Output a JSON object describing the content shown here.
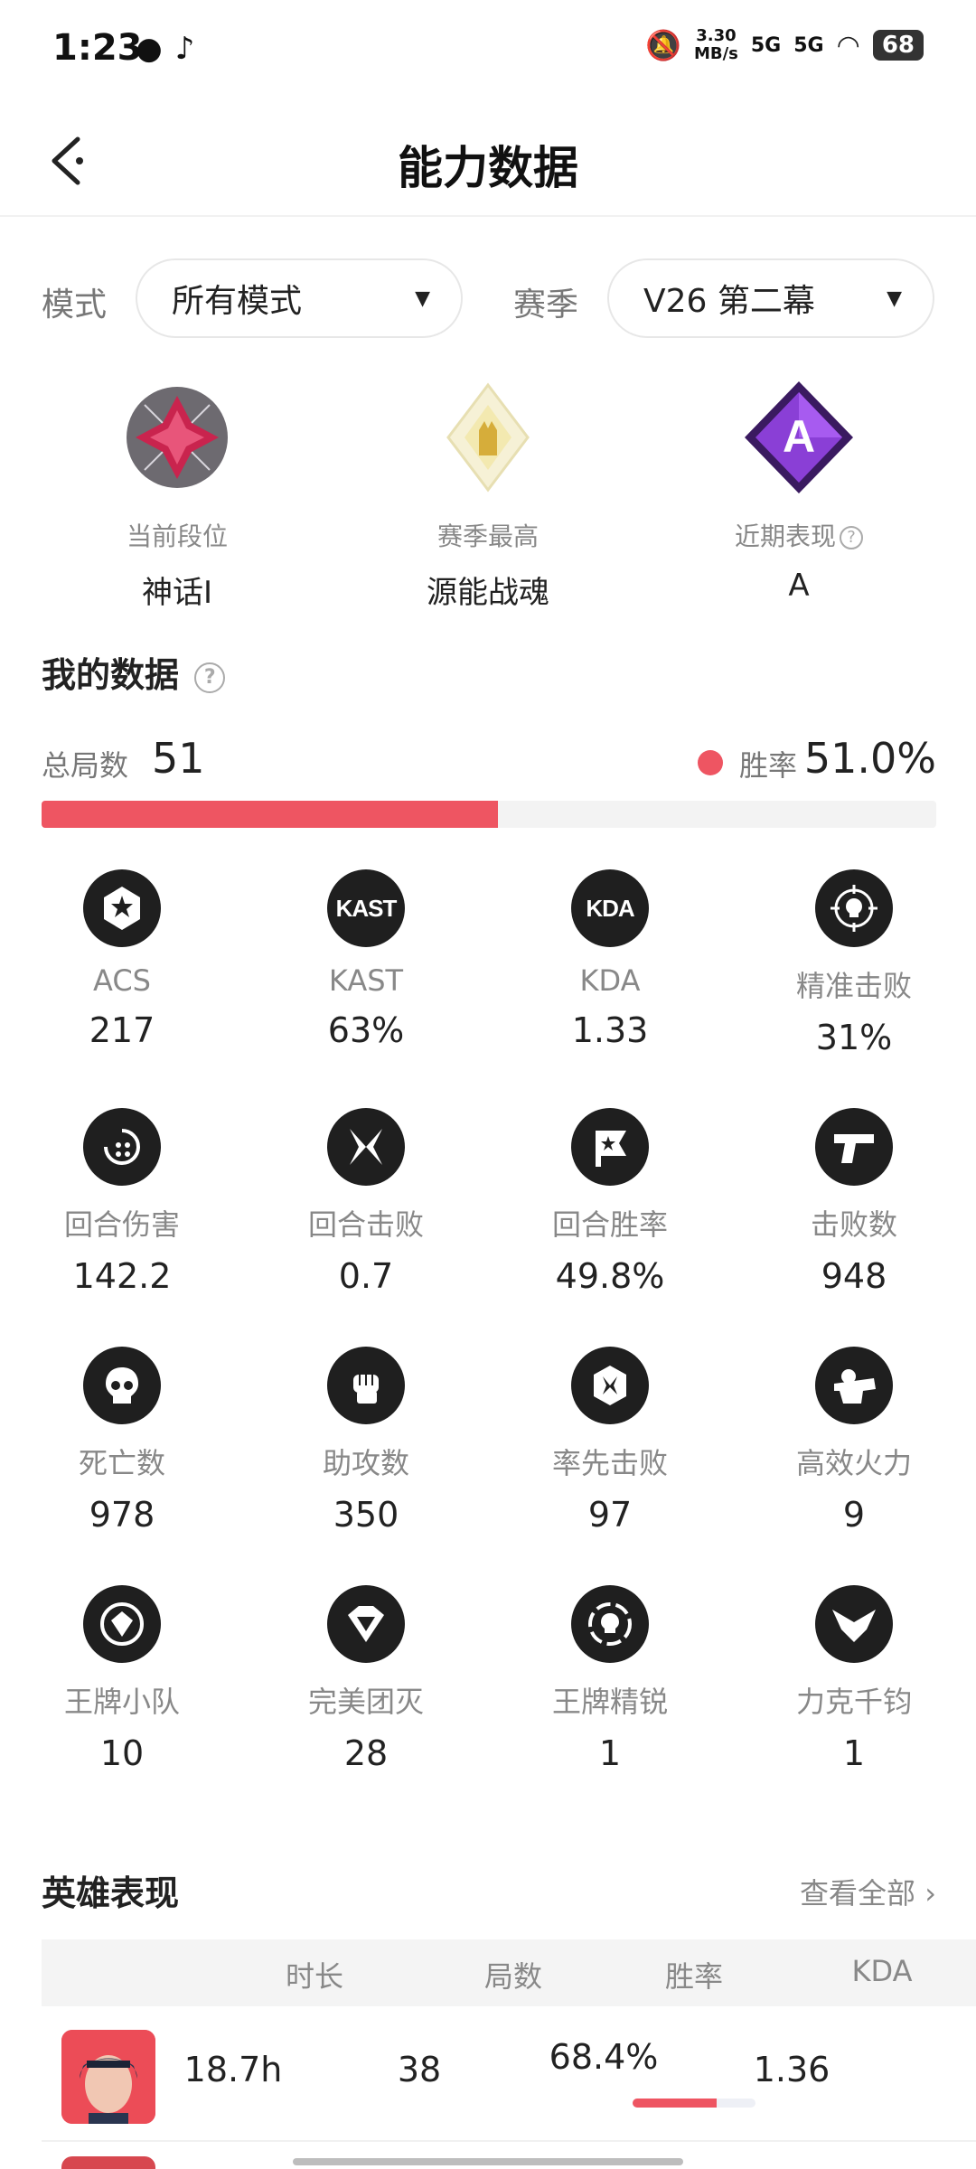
{
  "status_bar": {
    "time": "1:23",
    "net_speed_value": "3.30",
    "net_speed_unit": "MB/s",
    "signal_1": "5G",
    "signal_2": "5G",
    "battery": "68"
  },
  "nav": {
    "title": "能力数据"
  },
  "filters": {
    "mode_label": "模式",
    "mode_value": "所有模式",
    "season_label": "赛季",
    "season_value": "V26 第二幕"
  },
  "ranks": [
    {
      "label": "当前段位",
      "value": "神话I"
    },
    {
      "label": "赛季最高",
      "value": "源能战魂"
    },
    {
      "label": "近期表现",
      "value": "A"
    }
  ],
  "my_data": {
    "title": "我的数据",
    "total_label": "总局数",
    "total_value": "51",
    "winrate_label": "胜率",
    "winrate_value": "51.0%",
    "winrate_fraction": 0.51
  },
  "stats": [
    {
      "icon": "star-badge-icon",
      "label": "ACS",
      "value": "217"
    },
    {
      "icon": "kast-icon",
      "icon_text": "KAST",
      "label": "KAST",
      "value": "63%"
    },
    {
      "icon": "kda-icon",
      "icon_text": "KDA",
      "label": "KDA",
      "value": "1.33"
    },
    {
      "icon": "crosshair-skull-icon",
      "label": "精准击败",
      "value": "31%"
    },
    {
      "icon": "round-damage-icon",
      "label": "回合伤害",
      "value": "142.2"
    },
    {
      "icon": "crossed-blades-icon",
      "label": "回合击败",
      "value": "0.7"
    },
    {
      "icon": "flag-star-icon",
      "label": "回合胜率",
      "value": "49.8%"
    },
    {
      "icon": "pistol-icon",
      "label": "击败数",
      "value": "948"
    },
    {
      "icon": "skull-icon",
      "label": "死亡数",
      "value": "978"
    },
    {
      "icon": "fist-icon",
      "label": "助攻数",
      "value": "350"
    },
    {
      "icon": "first-blood-icon",
      "label": "率先击败",
      "value": "97"
    },
    {
      "icon": "heavy-gun-icon",
      "label": "高效火力",
      "value": "9"
    },
    {
      "icon": "ace-squad-icon",
      "label": "王牌小队",
      "value": "10"
    },
    {
      "icon": "diamond-shield-icon",
      "label": "完美团灭",
      "value": "28"
    },
    {
      "icon": "ace-elite-icon",
      "label": "王牌精锐",
      "value": "1"
    },
    {
      "icon": "eagle-icon",
      "label": "力克千钧",
      "value": "1"
    }
  ],
  "hero_section": {
    "title": "英雄表现",
    "view_all": "查看全部",
    "columns": [
      "时长",
      "局数",
      "胜率",
      "KDA"
    ],
    "rows": [
      {
        "duration": "18.7h",
        "games": "38",
        "winrate": "68.4%",
        "winrate_fraction": 0.684,
        "kda": "1.36"
      }
    ]
  },
  "colors": {
    "accent": "#ee5562",
    "icon_bg": "#1f1f1f",
    "muted_text": "#888888"
  }
}
